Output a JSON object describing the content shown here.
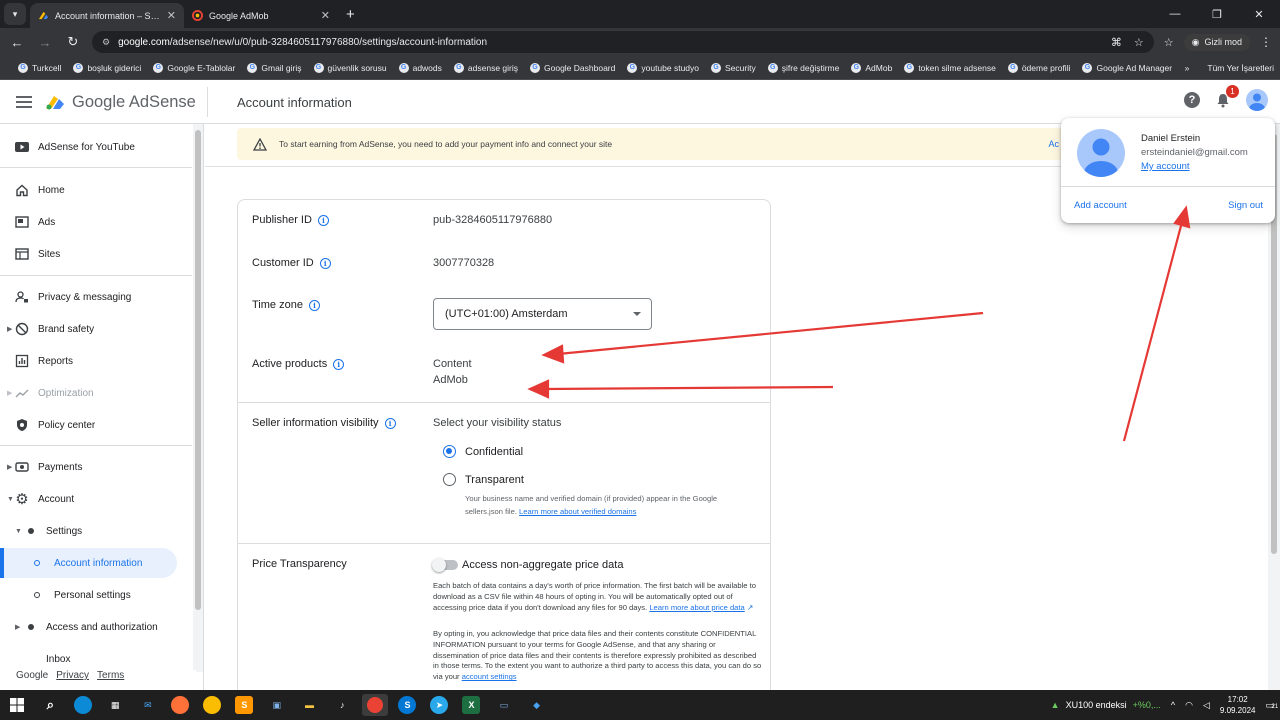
{
  "browser": {
    "tabs": [
      {
        "title": "Account information – Settings",
        "active": true
      },
      {
        "title": "Google AdMob",
        "active": false
      }
    ],
    "url_host": "google.com",
    "url_path": "/adsense/new/u/0/pub-3284605117976880/settings/account-information",
    "incognito_label": "Gizli mod",
    "bookmarks": [
      "Turkcell",
      "boşluk giderici",
      "Google E-Tablolar",
      "Gmail giriş",
      "güvenlik sorusu",
      "adwods",
      "adsense giriş",
      "Google Dashboard",
      "youtube studyo",
      "Security",
      "şifre değiştirme",
      "AdMob",
      "token silme adsense",
      "ödeme profili",
      "Google Ad Manager"
    ],
    "all_bookmarks_label": "Tüm Yer İşaretleri"
  },
  "header": {
    "logo_text": "Google AdSense",
    "page_title": "Account information",
    "notification_count": "1"
  },
  "sidebar": {
    "items": [
      {
        "label": "AdSense for YouTube",
        "icon": "youtube-icon"
      },
      {
        "label": "Home",
        "icon": "home-icon"
      },
      {
        "label": "Ads",
        "icon": "ads-icon"
      },
      {
        "label": "Sites",
        "icon": "sites-icon"
      },
      {
        "label": "Privacy & messaging",
        "icon": "privacy-icon"
      },
      {
        "label": "Brand safety",
        "icon": "block-icon"
      },
      {
        "label": "Reports",
        "icon": "reports-icon"
      },
      {
        "label": "Optimization",
        "icon": "trend-icon"
      },
      {
        "label": "Policy center",
        "icon": "shield-icon"
      },
      {
        "label": "Payments",
        "icon": "payments-icon"
      },
      {
        "label": "Account",
        "icon": "gear-icon"
      },
      {
        "label": "Settings"
      },
      {
        "label": "Account information"
      },
      {
        "label": "Personal settings"
      },
      {
        "label": "Access and authorization"
      },
      {
        "label": "Inbox"
      }
    ],
    "footer": {
      "google": "Google",
      "privacy": "Privacy",
      "terms": "Terms"
    }
  },
  "banner": {
    "text": "To start earning from AdSense, you need to add your payment info and connect your site",
    "action": "Ac"
  },
  "account": {
    "publisher_id_label": "Publisher ID",
    "publisher_id": "pub-3284605117976880",
    "customer_id_label": "Customer ID",
    "customer_id": "3007770328",
    "timezone_label": "Time zone",
    "timezone_value": "(UTC+01:00) Amsterdam",
    "active_products_label": "Active products",
    "active_products": [
      "Content",
      "AdMob"
    ],
    "seller_label": "Seller information visibility",
    "seller_prompt": "Select your visibility status",
    "seller_options": [
      "Confidential",
      "Transparent"
    ],
    "seller_help": "Your business name and verified domain (if provided) appear in the Google sellers.json file.",
    "seller_link": "Learn more about verified domains",
    "price_label": "Price Transparency",
    "price_toggle_label": "Access non-aggregate price data",
    "price_para1": "Each batch of data contains a day's worth of price information. The first batch will be available to download as a CSV file within 48 hours of opting in. You will be automatically opted out of accessing price data if you don't download any files for 90 days.",
    "price_link1": "Learn more about price data",
    "price_para2": "By opting in, you acknowledge that price data files and their contents constitute CONFIDENTIAL INFORMATION pursuant to your terms for Google AdSense, and that any sharing or dissemination of price data files and their contents is therefore expressly prohibited as described in those terms. To the extent you want to authorize a third party to access this data, you can do so via your",
    "price_link2": "account settings"
  },
  "popup": {
    "name": "Daniel Erstein",
    "email": "ersteindaniel@gmail.com",
    "my_account": "My account",
    "add_account": "Add account",
    "sign_out": "Sign out"
  },
  "taskbar": {
    "market_name": "XU100 endeksi",
    "market_change": "+%0,...",
    "time": "17:02",
    "date": "9.09.2024",
    "notif_count": "21"
  },
  "colors": {
    "accent": "#1a73e8",
    "annotation_arrow": "#e53935",
    "banner_bg": "#fef7e0"
  }
}
